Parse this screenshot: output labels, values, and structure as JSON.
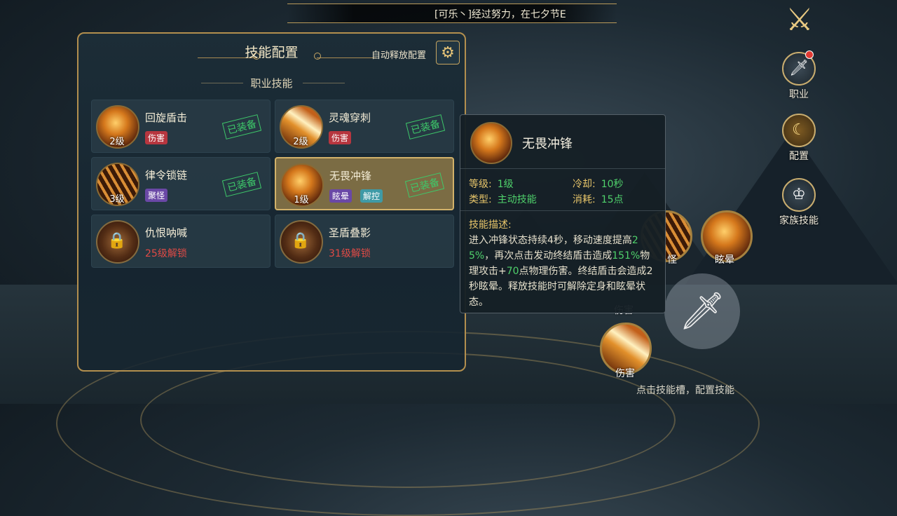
{
  "marquee": {
    "text": "[可乐丶]经过努力，在七夕节E"
  },
  "panel": {
    "title": "技能配置",
    "auto_release_label": "自动释放配置",
    "section_label": "职业技能",
    "skills": [
      {
        "name": "回旋盾击",
        "level": "2级",
        "tags": [
          "伤害"
        ],
        "status": "已装备"
      },
      {
        "name": "灵魂穿刺",
        "level": "2级",
        "tags": [
          "伤害"
        ],
        "status": "已装备"
      },
      {
        "name": "律令锁链",
        "level": "3级",
        "tags": [
          "聚怪"
        ],
        "status": "已装备"
      },
      {
        "name": "无畏冲锋",
        "level": "1级",
        "tags": [
          "眩晕",
          "解控"
        ],
        "status": "已装备"
      },
      {
        "name": "仇恨呐喊",
        "unlock": "25级解锁"
      },
      {
        "name": "圣盾叠影",
        "unlock": "31级解锁"
      }
    ]
  },
  "tooltip": {
    "title": "无畏冲锋",
    "level_label": "等级:",
    "level_value": "1级",
    "cooldown_label": "冷却:",
    "cooldown_value": "10秒",
    "type_label": "类型:",
    "type_value": "主动技能",
    "cost_label": "消耗:",
    "cost_value": "15点",
    "desc_heading": "技能描述:",
    "desc_parts": [
      "进入冲锋状态持续",
      "4秒",
      "，移动速度提高",
      "25%",
      "，再次点击发动终结盾击造成",
      "151%",
      "物理攻击+",
      "70",
      "点物理伤害。终结盾击会造成",
      "2秒",
      "眩晕。释放技能时可解除定身和眩晕状态。"
    ]
  },
  "side_nav": {
    "class_label": "职业",
    "config_label": "配置",
    "family_label": "家族技能"
  },
  "wheel": {
    "stun_label": "眩晕",
    "gather_label_partial": "怪",
    "damage_label": "伤害",
    "partial_top_label": "伤害"
  },
  "hint": "点击技能槽，配置技能",
  "icons": {
    "gear": "gear-icon",
    "close": "crossed-swords-icon",
    "class": "sword-icon",
    "config": "moon-star-icon",
    "family": "crest-icon",
    "attack": "sword-icon",
    "lock": "lock-icon"
  },
  "colors": {
    "gold_border": "#b38f4e",
    "equipped_green": "#3ec96a",
    "unlock_red": "#e04a45",
    "highlight_green": "#4fd16b"
  }
}
